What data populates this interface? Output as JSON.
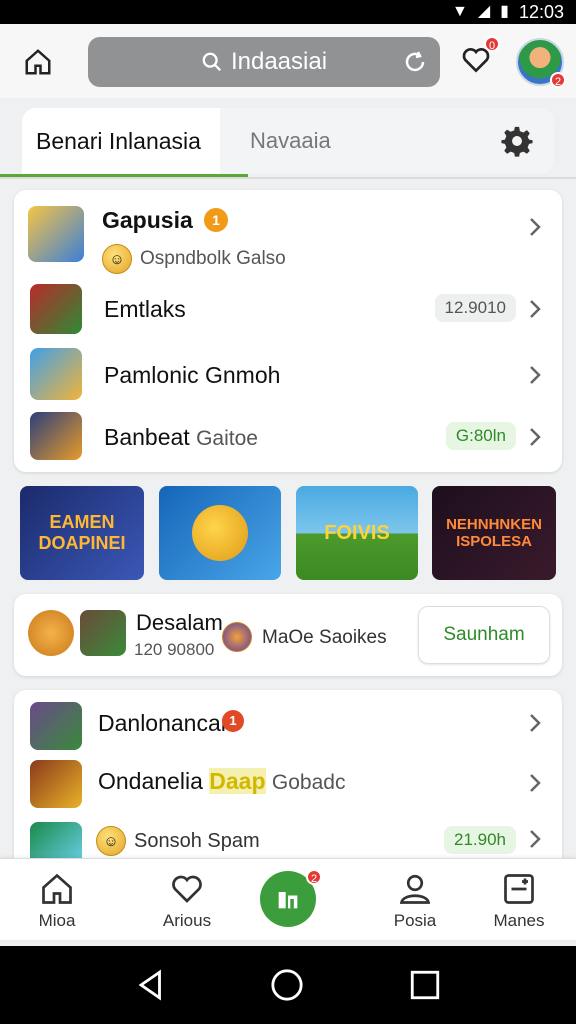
{
  "status_bar": {
    "time": "12:03"
  },
  "header": {
    "search_text": "Indaasiai",
    "heart_badge": "0",
    "avatar_badge": "2"
  },
  "tabs": {
    "active": "Benari Inlanasia",
    "second": "Navaaia"
  },
  "list1": [
    {
      "title": "Gapusia",
      "badge": "1",
      "subtitle": "Ospndbolk Galso",
      "pill": ""
    },
    {
      "title": "Emtlaks",
      "pill": "12.9010"
    },
    {
      "title": "Pamlonic Gnmoh",
      "pill": ""
    },
    {
      "title": "Banbeat",
      "title_suffix": "Gaitoe",
      "pill": "G:80ln"
    }
  ],
  "banners": [
    {
      "text": "EAMEN DOAPINEI",
      "bg": "#2a3d8f"
    },
    {
      "text": "",
      "bg": "#1f76c7"
    },
    {
      "text": "FOIVIS",
      "bg": "#3a9dd8"
    },
    {
      "text": "NEHNHNKEN ISPOLESA",
      "bg": "#2a1626"
    }
  ],
  "promo": {
    "title": "Desalam",
    "sub": "120 90800",
    "mid": "MaOe Saoikes",
    "button": "Saunham"
  },
  "list2": [
    {
      "title": "Danlonancan",
      "badge": "1",
      "pill": ""
    },
    {
      "title": "Ondanelia",
      "highlight": "Daap",
      "suffix": "Gobadc",
      "pill": ""
    },
    {
      "title": "Sonsoh Spam",
      "pill": "21.90h"
    }
  ],
  "bottom_nav": [
    "Mioa",
    "Arious",
    "",
    "Posia",
    "Manes"
  ],
  "fab_badge": "2",
  "colors": {
    "accent_green": "#3c9d3c",
    "badge_red": "#e53935",
    "badge_orange": "#f19a17"
  }
}
